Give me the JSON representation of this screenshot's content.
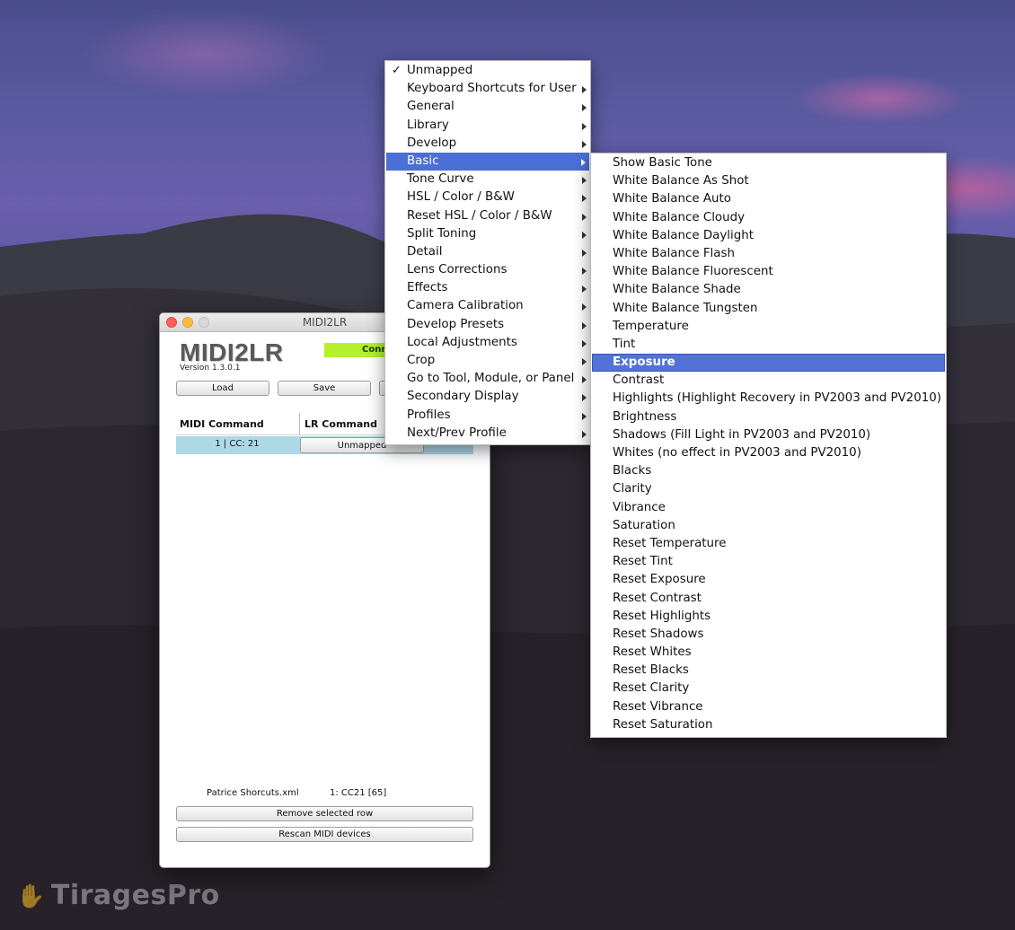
{
  "app": {
    "window_title": "MIDI2LR",
    "logo_text": "MIDI2LR",
    "version": "Version 1.3.0.1",
    "status_text": "Conn",
    "colors": {
      "status": "#b4f02c",
      "row_highlight": "#add8e6",
      "menu_selection": "#4b6fd6"
    }
  },
  "toolbar": {
    "load_label": "Load",
    "save_label": "Save",
    "third_label": ""
  },
  "table": {
    "headers": [
      "MIDI Command",
      "LR Command"
    ],
    "rows": [
      {
        "midi": "1 | CC: 21",
        "lr": "Unmapped"
      }
    ]
  },
  "footer": {
    "file_name": "Patrice Shorcuts.xml",
    "last_message": "1: CC21 [65]",
    "remove_label": "Remove selected row",
    "rescan_label": "Rescan MIDI devices"
  },
  "menu": {
    "checkmark": "✓",
    "items": [
      {
        "label": "Unmapped",
        "checked": true,
        "submenu": false
      },
      {
        "label": "Keyboard Shortcuts for User",
        "submenu": true
      },
      {
        "label": "General",
        "submenu": true
      },
      {
        "label": "Library",
        "submenu": true
      },
      {
        "label": "Develop",
        "submenu": true
      },
      {
        "label": "Basic",
        "submenu": true,
        "selected": true
      },
      {
        "label": "Tone Curve",
        "submenu": true
      },
      {
        "label": "HSL / Color / B&W",
        "submenu": true
      },
      {
        "label": "Reset HSL / Color / B&W",
        "submenu": true
      },
      {
        "label": "Split Toning",
        "submenu": true
      },
      {
        "label": "Detail",
        "submenu": true
      },
      {
        "label": "Lens Corrections",
        "submenu": true
      },
      {
        "label": "Effects",
        "submenu": true
      },
      {
        "label": "Camera Calibration",
        "submenu": true
      },
      {
        "label": "Develop Presets",
        "submenu": true
      },
      {
        "label": "Local Adjustments",
        "submenu": true
      },
      {
        "label": "Crop",
        "submenu": true
      },
      {
        "label": "Go to Tool, Module, or Panel",
        "submenu": true
      },
      {
        "label": "Secondary Display",
        "submenu": true
      },
      {
        "label": "Profiles",
        "submenu": true
      },
      {
        "label": "Next/Prev Profile",
        "submenu": true
      }
    ]
  },
  "submenu": {
    "items": [
      {
        "label": "Show Basic Tone"
      },
      {
        "label": "White Balance As Shot"
      },
      {
        "label": "White Balance Auto"
      },
      {
        "label": "White Balance Cloudy"
      },
      {
        "label": "White Balance Daylight"
      },
      {
        "label": "White Balance Flash"
      },
      {
        "label": "White Balance Fluorescent"
      },
      {
        "label": "White Balance Shade"
      },
      {
        "label": "White Balance Tungsten"
      },
      {
        "label": "Temperature"
      },
      {
        "label": "Tint"
      },
      {
        "label": "Exposure",
        "selected": true
      },
      {
        "label": "Contrast"
      },
      {
        "label": "Highlights (Highlight Recovery in PV2003 and PV2010)"
      },
      {
        "label": "Brightness"
      },
      {
        "label": "Shadows (Fill Light in PV2003 and PV2010)"
      },
      {
        "label": "Whites (no effect in PV2003 and PV2010)"
      },
      {
        "label": "Blacks"
      },
      {
        "label": "Clarity"
      },
      {
        "label": "Vibrance"
      },
      {
        "label": "Saturation"
      },
      {
        "label": "Reset Temperature"
      },
      {
        "label": "Reset Tint"
      },
      {
        "label": "Reset Exposure"
      },
      {
        "label": "Reset Contrast"
      },
      {
        "label": "Reset Highlights"
      },
      {
        "label": "Reset Shadows"
      },
      {
        "label": "Reset Whites"
      },
      {
        "label": "Reset Blacks"
      },
      {
        "label": "Reset Clarity"
      },
      {
        "label": "Reset Vibrance"
      },
      {
        "label": "Reset Saturation"
      }
    ]
  },
  "watermark": {
    "text": "TiragesPro",
    "icon": "hand-icon"
  }
}
